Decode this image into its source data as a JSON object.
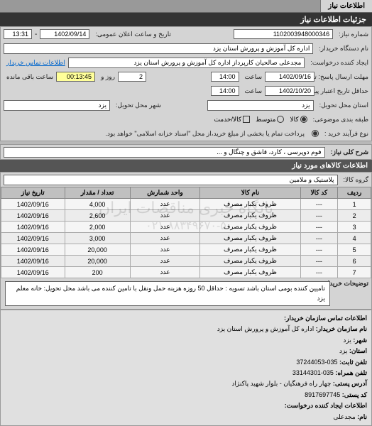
{
  "header": {
    "title": "جزئیات اطلاعات نیاز"
  },
  "tabs": [
    {
      "label": "اطلاعات نیاز",
      "active": true
    }
  ],
  "form": {
    "number_label": "شماره نیاز:",
    "number": "1102003948000346",
    "datetime_label": "تاریخ و ساعت اعلان عمومی:",
    "date": "1402/09/14",
    "time": "13:31",
    "buyer_label": "نام دستگاه خریدار:",
    "buyer": "اداره کل آموزش و پرورش استان یزد",
    "buyer_contact_label": "اطلاعات تماس خریدار",
    "requester_label": "ایجاد کننده درخواست:",
    "requester": "مجدعلی صالحیان کارپرداز اداره کل آموزش و پرورش استان یزد",
    "deadline_send_label": "مهلت ارسال پاسخ: تا تاریخ:",
    "deadline_send_date": "1402/09/16",
    "deadline_send_time_label": "ساعت",
    "deadline_send_time": "14:00",
    "remain_label": "ساعت باقی مانده",
    "remain_days": "2",
    "remain_days_label": "روز و",
    "remain_time": "00:13:45",
    "validity_label": "حداقل تاریخ اعتبار پیشنهاد: تا تاریخ:",
    "validity_date": "1402/10/20",
    "validity_time_label": "ساعت",
    "validity_time": "14:00",
    "province_label": "استان محل تحویل:",
    "province": "یزد",
    "city_label": "شهر محل تحویل:",
    "city": "یزد",
    "category_label": "طبقه بندی موضوعی:",
    "cat_goods": "کالا",
    "cat_medium": "متوسط",
    "cat_service": "کالا/خدمت",
    "process_label": "نوع فرآیند خرید :",
    "process_value": "پرداخت تمام یا بخشی از مبلغ خرید،از محل \"اسناد خزانه اسلامی\" خواهد بود."
  },
  "summary": {
    "label": "شرح کلی نیاز:",
    "value": "فوم دوپرسی ، کارد، قاشق و چنگال و ..."
  },
  "items_header": "اطلاعات کالاهای مورد نیاز",
  "group_label": "گروه کالا:",
  "group_value": "پلاستیک و ملامین",
  "table": {
    "cols": [
      "ردیف",
      "کد کالا",
      "نام کالا",
      "واحد شمارش",
      "تعداد / مقدار",
      "تاریخ نیاز"
    ],
    "rows": [
      [
        "1",
        "---",
        "ظروف یکبار مصرف",
        "عدد",
        "4,000",
        "1402/09/16"
      ],
      [
        "2",
        "---",
        "ظروف یکبار مصرف",
        "عدد",
        "2,600",
        "1402/09/16"
      ],
      [
        "3",
        "---",
        "ظروف یکبار مصرف",
        "عدد",
        "2,000",
        "1402/09/16"
      ],
      [
        "4",
        "---",
        "ظروف یکبار مصرف",
        "عدد",
        "3,000",
        "1402/09/16"
      ],
      [
        "5",
        "---",
        "ظروف یکبار مصرف",
        "عدد",
        "20,000",
        "1402/09/16"
      ],
      [
        "6",
        "---",
        "ظروف یکبار مصرف",
        "عدد",
        "20,000",
        "1402/09/16"
      ],
      [
        "7",
        "---",
        "ظروف یکبار مصرف",
        "عدد",
        "200",
        "1402/09/16"
      ]
    ]
  },
  "buyer_desc": {
    "label": "توضیحات خریدار:",
    "value": "تامیین کننده بومی استان باشد تسویه : حداقل 50 روزه هزینه حمل ونقل با تامین کننده می باشد محل تحویل: خانه معلم یزد"
  },
  "footer": {
    "title": "اطلاعات تماس سازمان خریدار:",
    "org_label": "نام سازمان خریدار:",
    "org": "اداره کل آموزش و پرورش استان یزد",
    "city_label": "شهر:",
    "city": "یزد",
    "province_label": "استان:",
    "province": "یزد",
    "phone_label": "تلفن ثابت:",
    "phone": "035-37244053",
    "fax_label": "تلفن همراه:",
    "fax": "035-33144301",
    "address_label": "آدرس پستی:",
    "address": "چهار راه فرهنگیان - بلوار شهید پاکنژاد",
    "postal_label": "کد پستی:",
    "postal": "8917697745",
    "creator_label": "اطلاعات ایجاد کننده درخواست:",
    "name_label": "نام:",
    "name": "مجدعلی"
  },
  "watermark": {
    "line1": "پایگاه خبری مناقصات ایران",
    "line2": "۰۲۱-۸۸۳۴۹۶۷۰-۵"
  }
}
